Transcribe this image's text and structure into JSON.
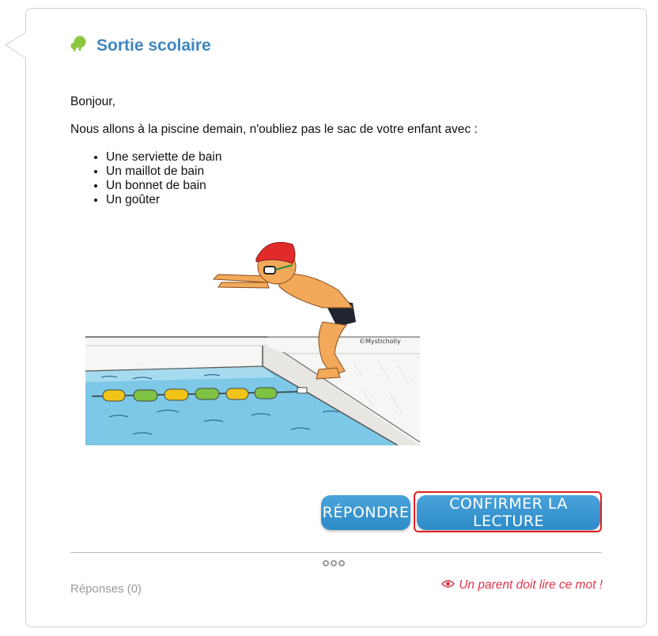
{
  "post": {
    "title": "Sortie scolaire",
    "icon": "tree-icon",
    "greeting": "Bonjour,",
    "message": "Nous allons à la piscine demain, n'oubliez pas le sac de votre enfant avec :",
    "items": [
      "Une serviette de bain",
      "Un maillot de bain",
      "Un bonnet de bain",
      "Un goûter"
    ],
    "illustration": {
      "signature": "©Mysticholly"
    }
  },
  "actions": {
    "reply_label": "RÉPONDRE",
    "confirm_label": "CONFIRMER LA LECTURE"
  },
  "footer": {
    "replies_label": "Réponses (0)",
    "warning_text": "Un parent doit lire ce mot !",
    "warning_icon": "eye-icon"
  },
  "colors": {
    "title": "#3f86c0",
    "button": "#3a97d2",
    "warning": "#e0344a",
    "highlight": "#e02020",
    "icon": "#8cc63f"
  }
}
